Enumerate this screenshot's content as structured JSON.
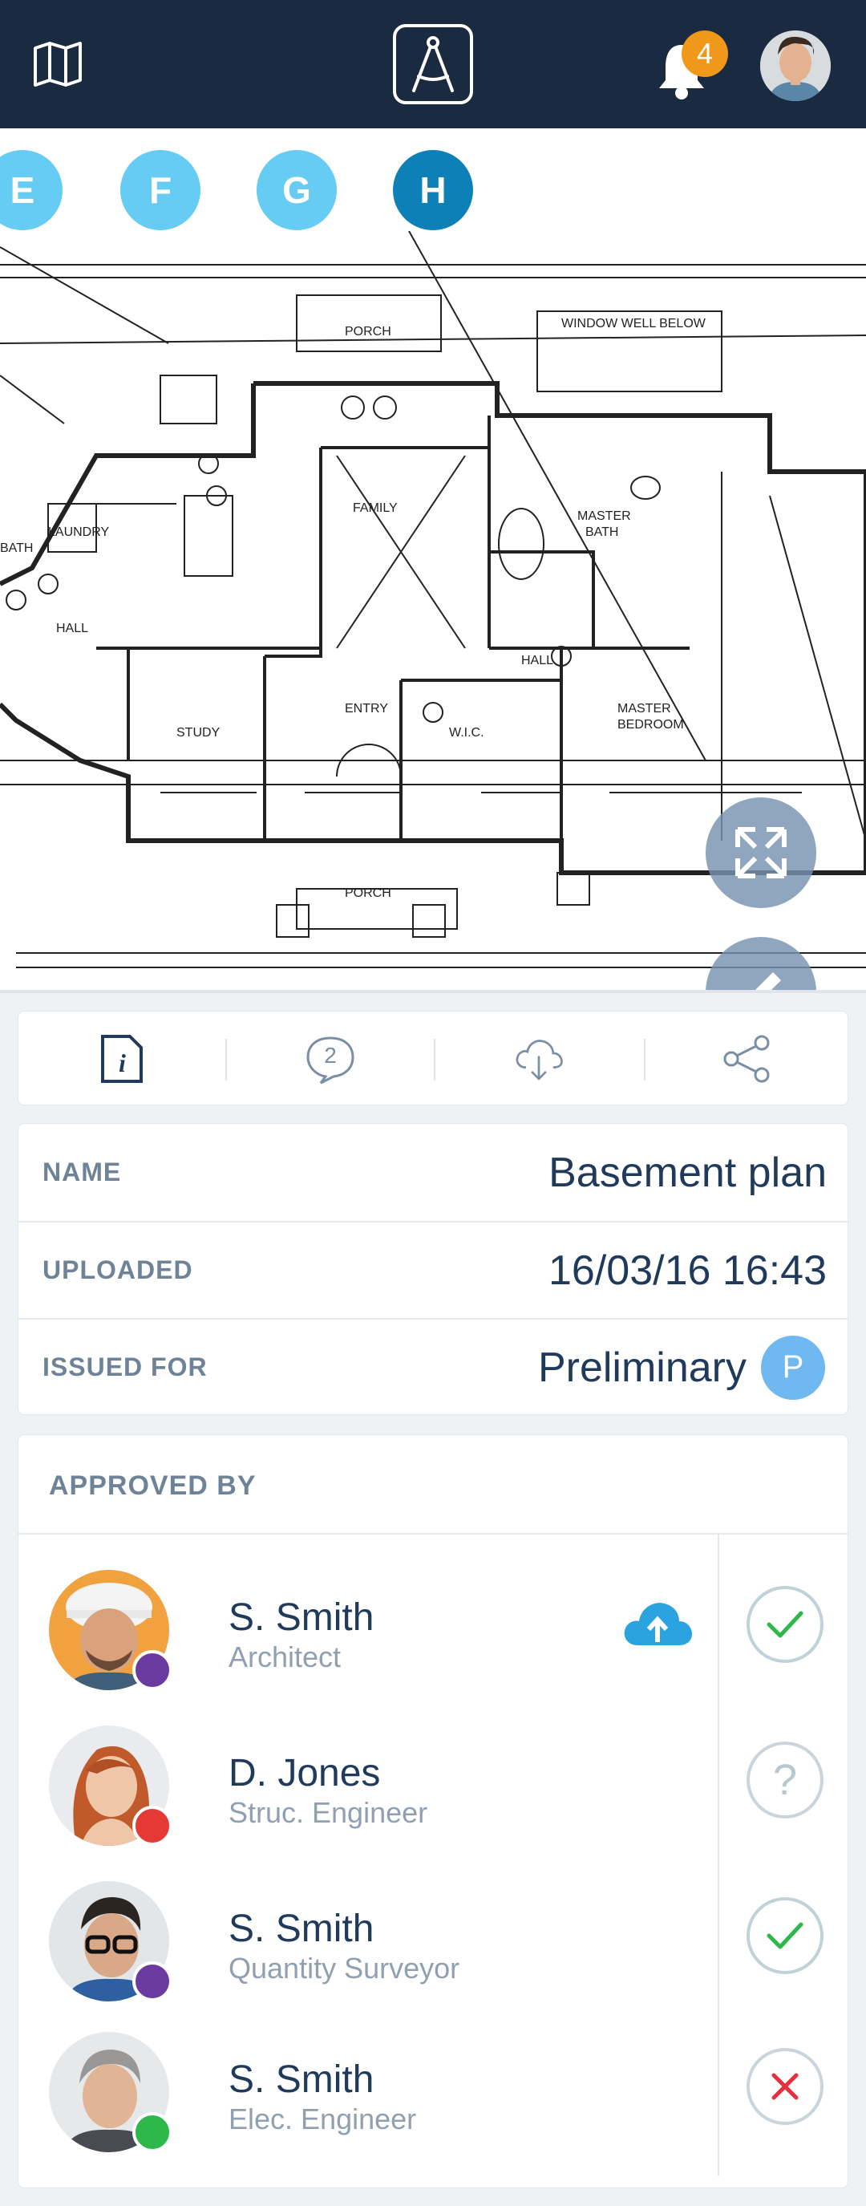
{
  "header": {
    "notification_count": "4"
  },
  "sheet_tabs": [
    "E",
    "F",
    "G",
    "H"
  ],
  "active_tab": "H",
  "colors": {
    "brand": "#1a2a40",
    "tab": "#67ccf3",
    "tab_active": "#0d80b8",
    "accent": "#f0981a",
    "approve": "#2eb84a",
    "reject": "#e6303d"
  },
  "icons": [
    "map-icon",
    "compass-logo-icon",
    "bell-icon",
    "expand-icon",
    "edit-icon",
    "lock-icon",
    "info-icon",
    "comment-icon",
    "cloud-download-icon",
    "share-icon",
    "cloud-upload-icon"
  ],
  "actions": {
    "comment_count": "2"
  },
  "details": {
    "name_label": "NAME",
    "name_value": "Basement plan",
    "uploaded_label": "UPLOADED",
    "uploaded_value": "16/03/16 16:43",
    "issued_label": "ISSUED FOR",
    "issued_value": "Preliminary",
    "issued_badge": "P"
  },
  "approved": {
    "title": "APPROVED BY",
    "people": [
      {
        "name": "S. Smith",
        "role": "Architect",
        "dot": "#6a3aa0",
        "status": "approved",
        "has_upload": true
      },
      {
        "name": "D. Jones",
        "role": "Struc. Engineer",
        "dot": "#e53935",
        "status": "pending",
        "has_upload": false
      },
      {
        "name": "S. Smith",
        "role": "Quantity Surveyor",
        "dot": "#6a3aa0",
        "status": "approved",
        "has_upload": false
      },
      {
        "name": "S. Smith",
        "role": "Elec. Engineer",
        "dot": "#2eb84a",
        "status": "rejected",
        "has_upload": false
      }
    ]
  }
}
